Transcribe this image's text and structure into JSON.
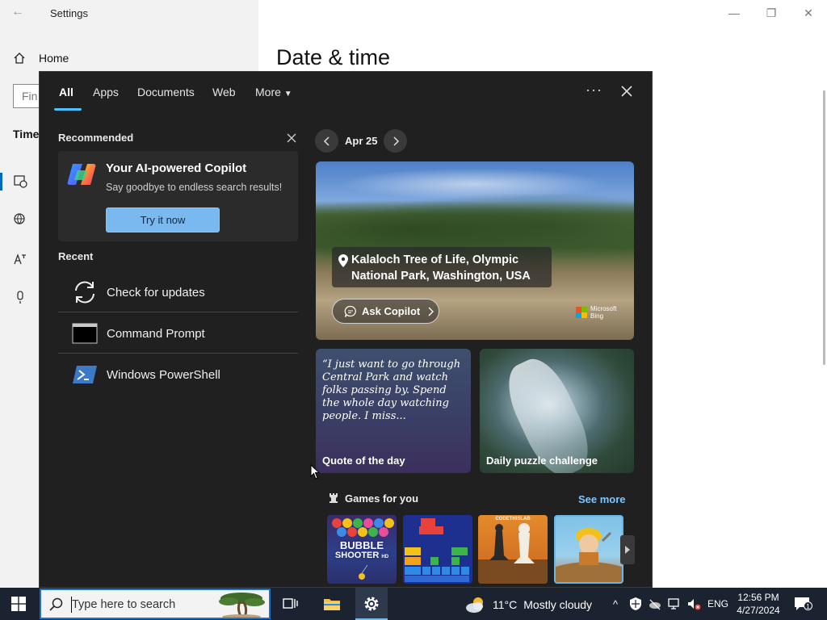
{
  "settings": {
    "window_title": "Settings",
    "home_label": "Home",
    "find_placeholder": "Fin",
    "section_heading": "Time",
    "page_title": "Date & time"
  },
  "search_panel": {
    "tabs": [
      {
        "label": "All",
        "active": true
      },
      {
        "label": "Apps"
      },
      {
        "label": "Documents"
      },
      {
        "label": "Web"
      },
      {
        "label": "More"
      }
    ],
    "recommended": {
      "heading": "Recommended",
      "card_title": "Your AI-powered Copilot",
      "card_subtitle": "Say goodbye to endless search results!",
      "card_button": "Try it now"
    },
    "recent": {
      "heading": "Recent",
      "items": [
        {
          "label": "Check for updates",
          "icon": "refresh-icon"
        },
        {
          "label": "Command Prompt",
          "icon": "command-prompt-icon"
        },
        {
          "label": "Windows PowerShell",
          "icon": "powershell-icon"
        }
      ]
    },
    "highlights": {
      "date": "Apr 25",
      "hero_location": "Kalaloch Tree of Life, Olympic National Park, Washington, USA",
      "ask_copilot": "Ask Copilot",
      "bing_line1": "Microsoft",
      "bing_line2": "Bing",
      "quote_text": "“I just want to go through Central Park and watch folks passing by. Spend the whole day watching people. I miss...",
      "quote_label": "Quote of the day",
      "puzzle_label": "Daily puzzle challenge",
      "games_heading": "Games for you",
      "see_more": "See more",
      "game_tiles": [
        {
          "name": "Bubble Shooter",
          "logo_line1": "BUBBLE",
          "logo_line2": "SHOOTER",
          "badge": "HD"
        },
        {
          "name": "Block puzzle"
        },
        {
          "name": "Chess",
          "brand": "CODETHISLAB"
        },
        {
          "name": "Miner"
        }
      ]
    }
  },
  "taskbar": {
    "search_placeholder": "Type here to search",
    "weather_temp": "11°C",
    "weather_desc": "Mostly cloudy",
    "language": "ENG",
    "time": "12:56 PM",
    "date": "4/27/2024",
    "notification_count": "1"
  },
  "colors": {
    "accent": "#4cc2ff",
    "panel_bg": "#202020",
    "button_blue": "#7ab8f0",
    "link": "#7cc7ff",
    "taskbar_bg": "#1b2330"
  }
}
